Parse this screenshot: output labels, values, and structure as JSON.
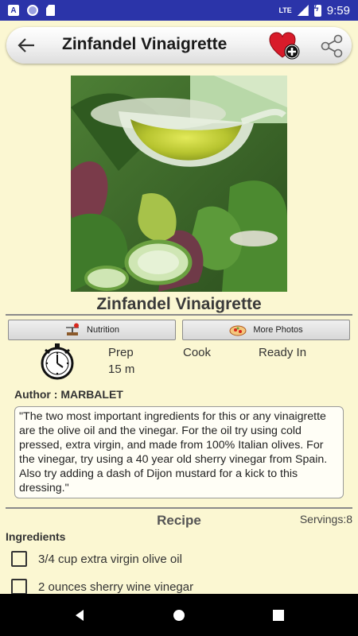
{
  "status_bar": {
    "badge_letter": "A",
    "network": "LTE",
    "time": "9:59"
  },
  "toolbar": {
    "title": "Zinfandel Vinaigrette",
    "back_icon": "arrow-left-icon",
    "favorite_icon": "heart-plus-icon",
    "share_icon": "share-icon",
    "favorite_color": "#d81b2a"
  },
  "recipe": {
    "title": "Zinfandel Vinaigrette",
    "photo_alt": "salad with vinaigrette",
    "nutrition_label": "Nutrition",
    "more_photos_label": "More Photos",
    "times": {
      "prep_label": "Prep",
      "prep_value": "15 m",
      "cook_label": "Cook",
      "ready_label": "Ready In"
    },
    "author": "Author : MARBALET",
    "description": "\"The two most important ingredients for this or any vinaigrette are the olive oil and the vinegar. For the oil try using cold pressed, extra virgin, and made from 100% Italian olives. For the vinegar, try using a 40 year old sherry vinegar from Spain. Also try adding a dash of Dijon mustard for a kick to this dressing.\"",
    "section_title": "Recipe",
    "servings": "Servings:8",
    "ingredients_heading": "Ingredients",
    "ingredients": [
      "3/4 cup extra virgin olive oil",
      "2 ounces sherry wine vinegar"
    ]
  },
  "colors": {
    "status_bar": "#2b34a9",
    "background": "#fbf7d2"
  }
}
